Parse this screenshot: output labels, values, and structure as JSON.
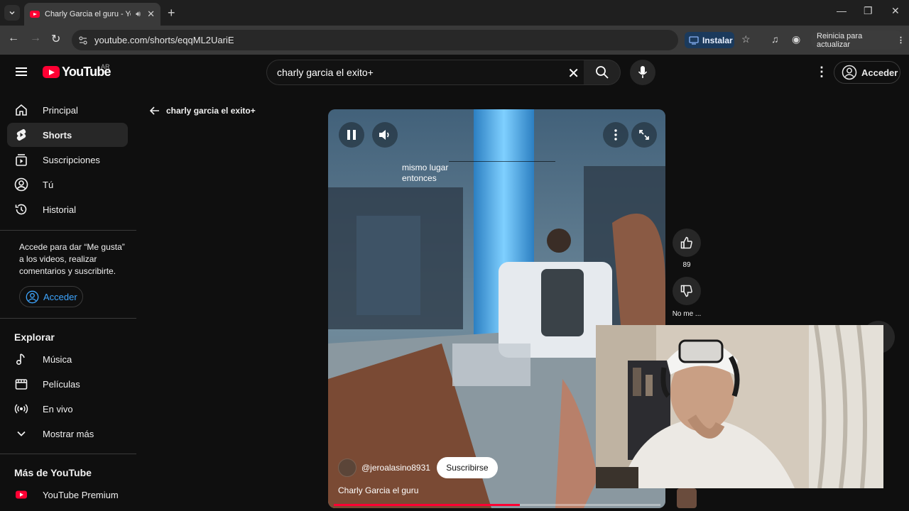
{
  "browser": {
    "tab_title": "Charly Garcia el guru - YouTube",
    "url": "youtube.com/shorts/eqqML2UariE",
    "install_label": "Instalar",
    "update_label": "Reinicia para actualizar"
  },
  "header": {
    "logo_text": "YouTube",
    "region": "AR",
    "search_value": "charly garcia el exito+",
    "signin_label": "Acceder"
  },
  "sidebar": {
    "items": [
      {
        "label": "Principal",
        "icon": "home-icon"
      },
      {
        "label": "Shorts",
        "icon": "shorts-icon"
      },
      {
        "label": "Suscripciones",
        "icon": "subscriptions-icon"
      },
      {
        "label": "Tú",
        "icon": "user-icon"
      },
      {
        "label": "Historial",
        "icon": "history-icon"
      }
    ],
    "signin_message": "Accede para dar “Me gusta” a los videos, realizar comentarios y suscribirte.",
    "signin_label": "Acceder",
    "explore_title": "Explorar",
    "explore_items": [
      {
        "label": "Música",
        "icon": "music-icon"
      },
      {
        "label": "Películas",
        "icon": "movies-icon"
      },
      {
        "label": "En vivo",
        "icon": "live-icon"
      },
      {
        "label": "Mostrar más",
        "icon": "chevron-down-icon"
      }
    ],
    "more_title": "Más de YouTube",
    "more_items": [
      {
        "label": "YouTube Premium",
        "icon": "youtube-premium-icon"
      }
    ]
  },
  "back_link": {
    "label": "charly garcia el exito+"
  },
  "player": {
    "caption_line1": "mismo lugar",
    "caption_line2": "entonces",
    "channel": "@jeroalasino8931",
    "subscribe_label": "Suscribirse",
    "title": "Charly Garcia el guru",
    "progress": 0.57
  },
  "actions": {
    "like_count": "89",
    "dislike_label": "No me ..."
  },
  "colors": {
    "accent_red": "#ff0033",
    "link_blue": "#3ea6ff",
    "background": "#0f0f0f"
  }
}
